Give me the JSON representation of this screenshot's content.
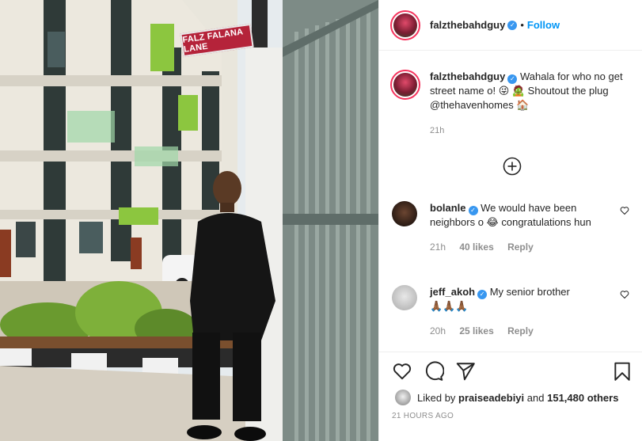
{
  "post": {
    "author": "falzthebahdguy",
    "follow_label": "Follow",
    "dot": "•",
    "sign_text": "FALZ FALANA LANE",
    "caption_text": "Wahala for who no get street name o! 😜 🧟 Shoutout the plug @thehavenhomes 🏠",
    "caption_time": "21h",
    "liked_by_prefix": "Liked by",
    "liked_by_user": "praiseadebiyi",
    "liked_by_mid": "and",
    "liked_by_count": "151,480 others",
    "date": "21 HOURS AGO"
  },
  "comments": [
    {
      "user": "bolanle",
      "text": "We would have been neighbors o 😂 congratulations hun",
      "time": "21h",
      "likes": "40 likes",
      "reply": "Reply"
    },
    {
      "user": "jeff_akoh",
      "text": "My senior brother",
      "text2": "🙏🏾🙏🏾🙏🏾",
      "time": "20h",
      "likes": "25 likes",
      "reply": "Reply"
    }
  ],
  "colors": {
    "accent": "#0095f6",
    "verified": "#3897f0",
    "meta": "#8e8e8e",
    "sign": "#b5233a"
  },
  "icons": [
    "verified-icon",
    "heart-icon",
    "comment-icon",
    "share-icon",
    "bookmark-icon",
    "add-circle-icon"
  ]
}
